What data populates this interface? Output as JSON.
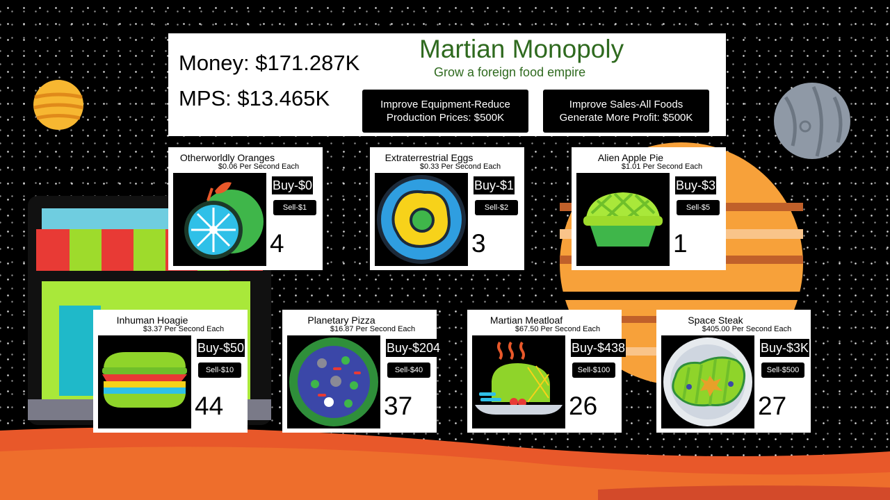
{
  "stats": {
    "money": "Money: $171.287K",
    "mps": "MPS: $13.465K"
  },
  "header": {
    "title": "Martian Monopoly",
    "subtitle": "Grow a foreign food empire"
  },
  "upgrades": {
    "equipment": {
      "line1": "Improve Equipment-Reduce",
      "line2": "Production Prices: $500K"
    },
    "sales": {
      "line1": "Improve Sales-All Foods",
      "line2": "Generate More Profit: $500K"
    }
  },
  "foods": [
    {
      "name": "Otherworldly Oranges",
      "rate": "$0.06 Per Second Each",
      "buy": "Buy-$0",
      "sell": "Sell-$1",
      "count": "4",
      "icon": "orange-icon"
    },
    {
      "name": "Extraterrestrial Eggs",
      "rate": "$0.33 Per Second Each",
      "buy": "Buy-$1",
      "sell": "Sell-$2",
      "count": "3",
      "icon": "fried-egg-icon"
    },
    {
      "name": "Alien Apple Pie",
      "rate": "$1.01 Per Second Each",
      "buy": "Buy-$3",
      "sell": "Sell-$5",
      "count": "1",
      "icon": "pie-icon"
    },
    {
      "name": "Inhuman Hoagie",
      "rate": "$3.37 Per Second Each",
      "buy": "Buy-$50",
      "sell": "Sell-$10",
      "count": "44",
      "icon": "sandwich-icon"
    },
    {
      "name": "Planetary Pizza",
      "rate": "$16.87 Per Second Each",
      "buy": "Buy-$204",
      "sell": "Sell-$40",
      "count": "37",
      "icon": "pizza-icon"
    },
    {
      "name": "Martian Meatloaf",
      "rate": "$67.50 Per Second Each",
      "buy": "Buy-$438",
      "sell": "Sell-$100",
      "count": "26",
      "icon": "meatloaf-icon"
    },
    {
      "name": "Space Steak",
      "rate": "$405.00 Per Second Each",
      "buy": "Buy-$3K",
      "sell": "Sell-$500",
      "count": "27",
      "icon": "steak-icon"
    }
  ],
  "colors": {
    "title": "#2f6a1f",
    "ground": "#e8582a",
    "panel": "#ffffff"
  }
}
